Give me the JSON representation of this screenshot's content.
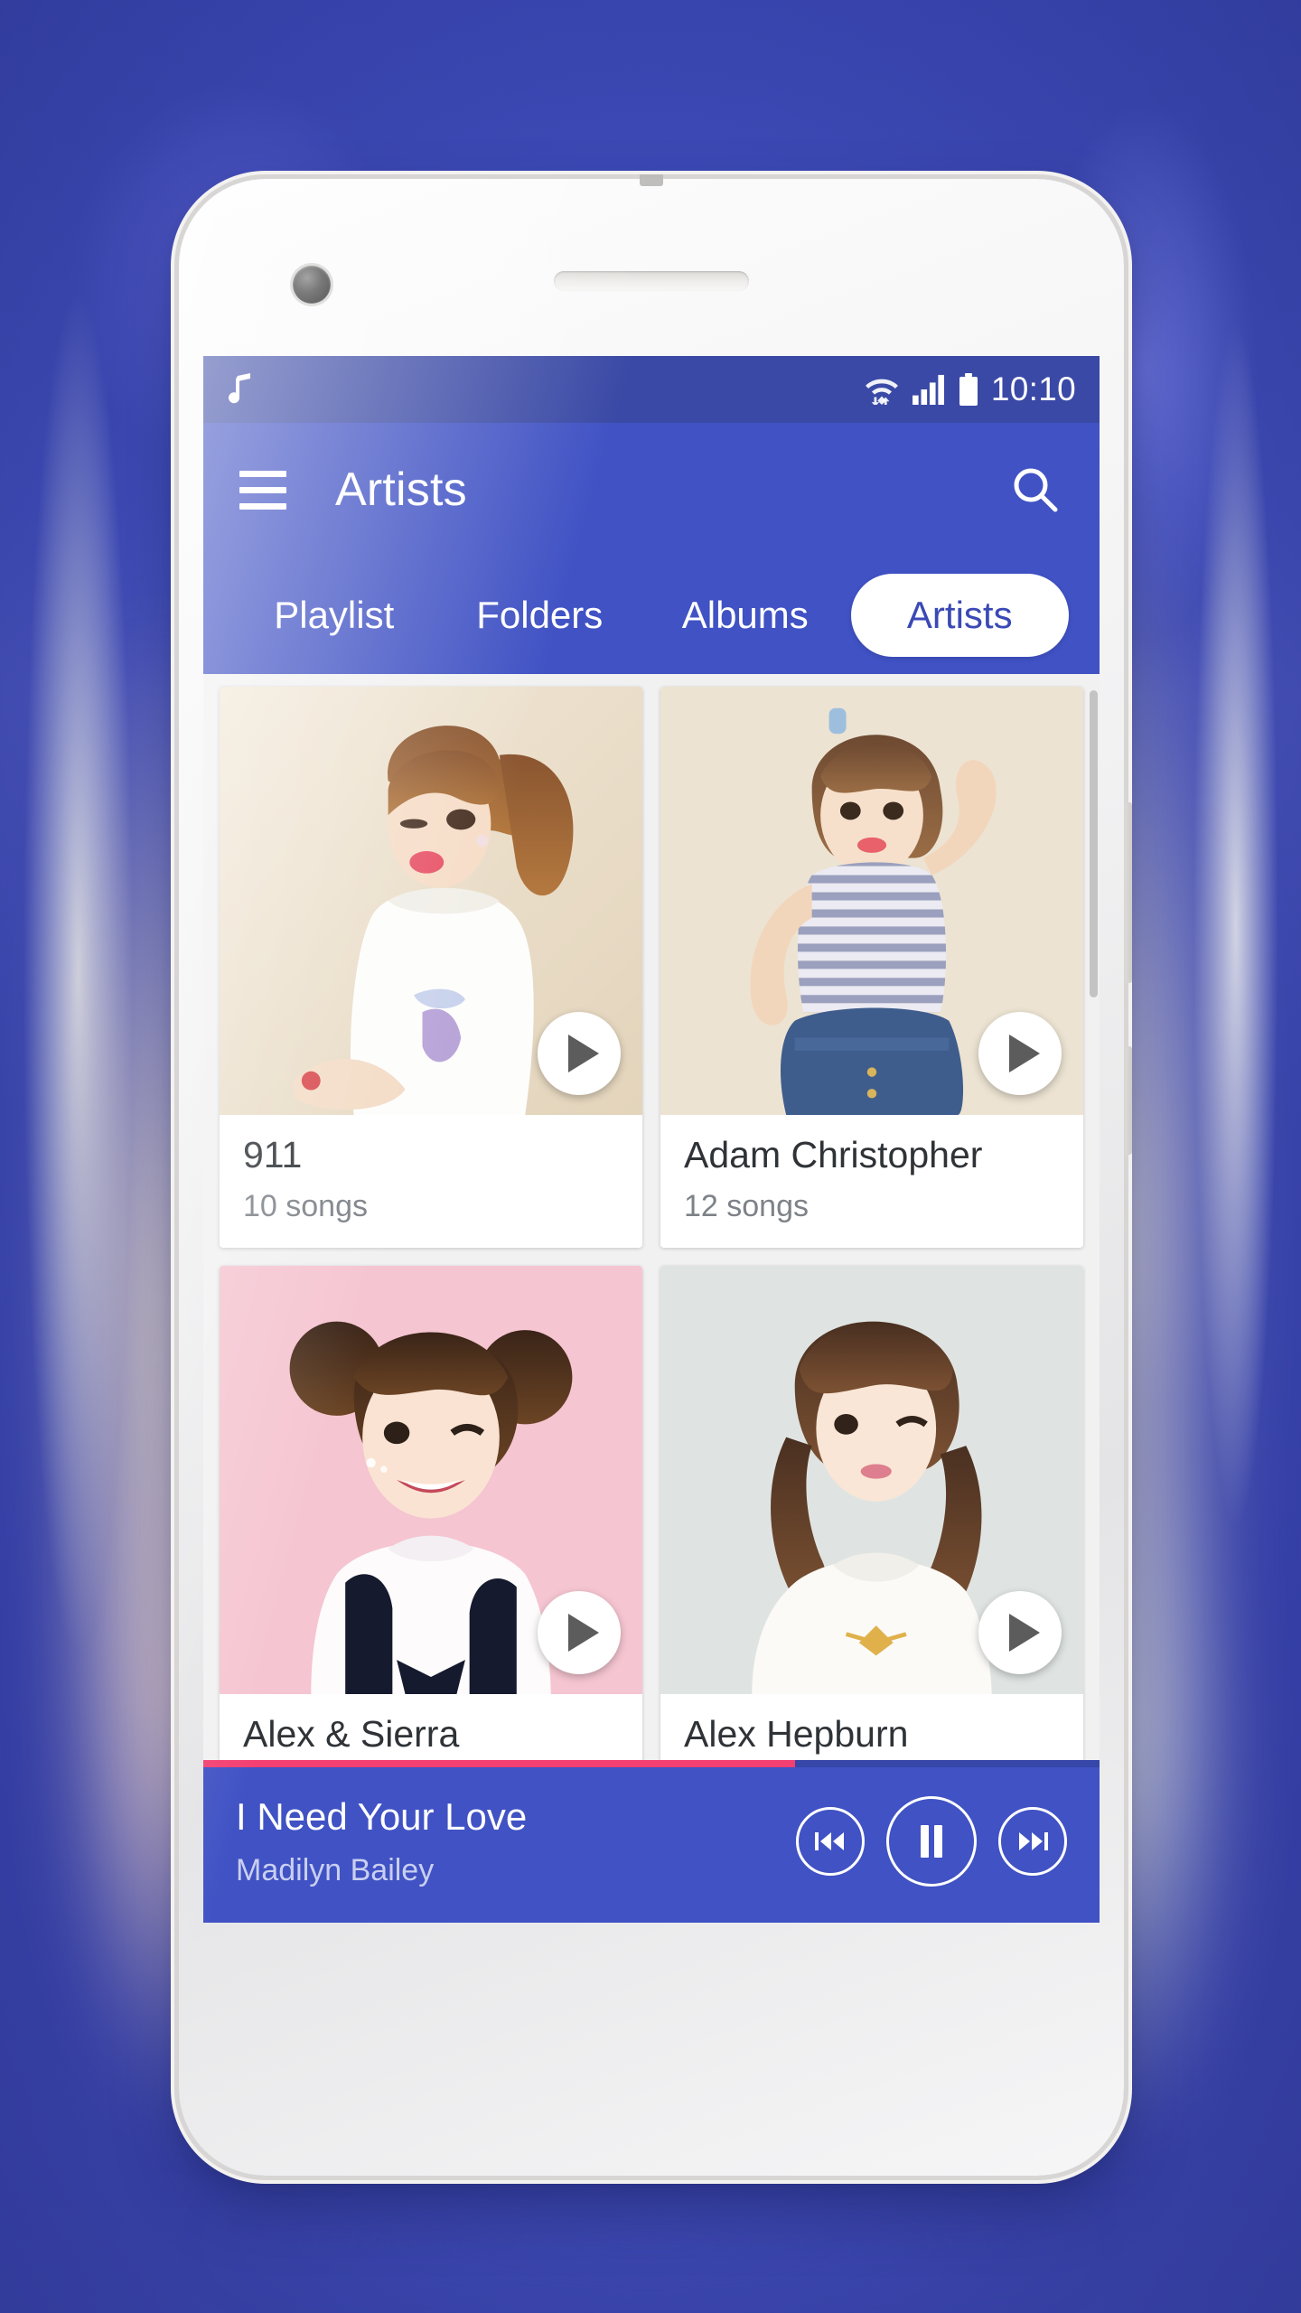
{
  "statusbar": {
    "notification_icon": "music-note-icon",
    "wifi_icon": "wifi-icon",
    "signal_icon": "signal-bars-icon",
    "battery_icon": "battery-icon",
    "time": "10:10"
  },
  "appbar": {
    "menu_icon": "hamburger-menu-icon",
    "title": "Artists",
    "search_icon": "search-icon"
  },
  "tabs": [
    {
      "label": "Playlist",
      "active": false
    },
    {
      "label": "Folders",
      "active": false
    },
    {
      "label": "Albums",
      "active": false
    },
    {
      "label": "Artists",
      "active": true
    }
  ],
  "artists": [
    {
      "name": "911",
      "songs": "10 songs",
      "play_icon": "play-icon"
    },
    {
      "name": "Adam Christopher",
      "songs": "12 songs",
      "play_icon": "play-icon"
    },
    {
      "name": "Alex & Sierra",
      "songs": "",
      "play_icon": "play-icon"
    },
    {
      "name": "Alex Hepburn",
      "songs": "",
      "play_icon": "play-icon"
    }
  ],
  "now_playing": {
    "title": "I Need Your Love",
    "artist": "Madilyn Bailey",
    "progress_percent": 66,
    "previous_icon": "skip-previous-icon",
    "playpause_icon": "pause-icon",
    "next_icon": "skip-next-icon"
  },
  "colors": {
    "status_bar": "#3a49a5",
    "app_bar": "#4052c4",
    "accent_pink": "#f43f72",
    "tab_active_text": "#3a49b5",
    "card_bg": "#ffffff",
    "content_bg": "#f1f1f1"
  }
}
